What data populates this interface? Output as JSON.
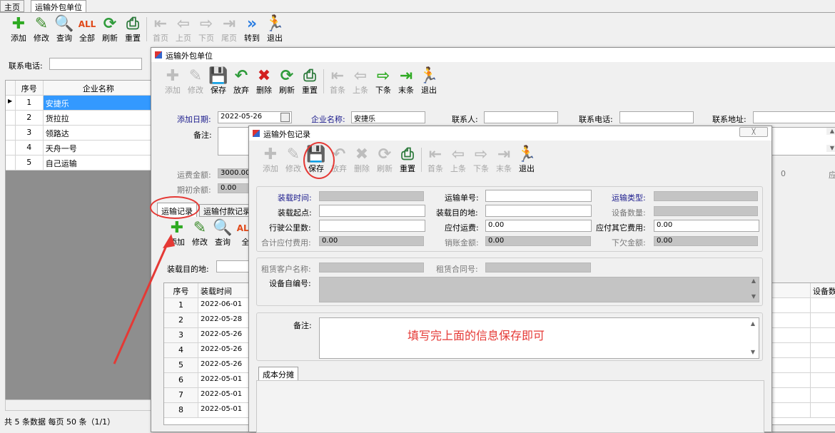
{
  "tabs": [
    "主页",
    "运输外包单位"
  ],
  "main_toolbar": [
    {
      "label": "添加",
      "icon": "add-icon",
      "enabled": true
    },
    {
      "label": "修改",
      "icon": "edit-icon",
      "enabled": true
    },
    {
      "label": "查询",
      "icon": "search-icon",
      "enabled": true
    },
    {
      "label": "全部",
      "icon": "all-icon",
      "enabled": true
    },
    {
      "label": "刷新",
      "icon": "refresh-icon",
      "enabled": true
    },
    {
      "label": "重置",
      "icon": "reset-icon",
      "enabled": true
    },
    {
      "label": "首页",
      "icon": "first-icon",
      "enabled": false
    },
    {
      "label": "上页",
      "icon": "prev-icon",
      "enabled": false
    },
    {
      "label": "下页",
      "icon": "next-icon",
      "enabled": false
    },
    {
      "label": "尾页",
      "icon": "last-icon",
      "enabled": false
    },
    {
      "label": "转到",
      "icon": "goto-icon",
      "enabled": true
    },
    {
      "label": "退出",
      "icon": "exit-icon",
      "enabled": true
    }
  ],
  "filter": {
    "phone_label": "联系电话:"
  },
  "company_grid": {
    "headers": [
      "序号",
      "企业名称"
    ],
    "rows": [
      {
        "no": "1",
        "name": "安捷乐"
      },
      {
        "no": "2",
        "name": "货拉拉"
      },
      {
        "no": "3",
        "name": "领路达"
      },
      {
        "no": "4",
        "name": "天舟一号"
      },
      {
        "no": "5",
        "name": "自己运输"
      }
    ]
  },
  "status": "共 5 条数据  每页 50 条（1/1）",
  "unit_window": {
    "title": "运输外包单位",
    "toolbar": [
      {
        "label": "添加",
        "icon": "add-icon",
        "enabled": false
      },
      {
        "label": "修改",
        "icon": "edit-icon",
        "enabled": false
      },
      {
        "label": "保存",
        "icon": "save-icon",
        "enabled": true
      },
      {
        "label": "放弃",
        "icon": "undo-icon",
        "enabled": true
      },
      {
        "label": "删除",
        "icon": "delete-icon",
        "enabled": true
      },
      {
        "label": "刷新",
        "icon": "refresh-icon",
        "enabled": true
      },
      {
        "label": "重置",
        "icon": "reset-icon",
        "enabled": true
      },
      {
        "label": "首条",
        "icon": "first-icon",
        "enabled": false
      },
      {
        "label": "上条",
        "icon": "prev-icon",
        "enabled": false
      },
      {
        "label": "下条",
        "icon": "next-icon",
        "enabled": true
      },
      {
        "label": "末条",
        "icon": "last-icon",
        "enabled": true
      },
      {
        "label": "退出",
        "icon": "exit-icon",
        "enabled": true
      }
    ],
    "add_date_label": "添加日期:",
    "add_date": "2022-05-26",
    "company_label": "企业名称:",
    "company": "安捷乐",
    "contact_label": "联系人:",
    "phone_label": "联系电话:",
    "address_label": "联系地址:",
    "remark_label": "备注:",
    "freight_label": "运费金额:",
    "freight": "3000.00",
    "opening_label": "期初余额:",
    "opening": "0.00",
    "right_value": "0",
    "right_suffix": "应",
    "subtabs": [
      "运输记录",
      "运输付款记录"
    ],
    "sub_toolbar": [
      {
        "label": "添加",
        "icon": "add-icon"
      },
      {
        "label": "修改",
        "icon": "edit-icon"
      },
      {
        "label": "查询",
        "icon": "search-icon"
      },
      {
        "label": "全",
        "icon": "all-icon"
      }
    ],
    "dest_label": "装载目的地:",
    "record_headers": [
      "序号",
      "装载时间"
    ],
    "right_header": "设备数",
    "records": [
      {
        "no": "1",
        "date": "2022-06-01"
      },
      {
        "no": "2",
        "date": "2022-05-28"
      },
      {
        "no": "3",
        "date": "2022-05-26"
      },
      {
        "no": "4",
        "date": "2022-05-26"
      },
      {
        "no": "5",
        "date": "2022-05-26"
      },
      {
        "no": "6",
        "date": "2022-05-01"
      },
      {
        "no": "7",
        "date": "2022-05-01"
      },
      {
        "no": "8",
        "date": "2022-05-01"
      }
    ]
  },
  "record_window": {
    "title": "运输外包记录",
    "close_label": "╳",
    "toolbar": [
      {
        "label": "添加",
        "icon": "add-icon",
        "enabled": false
      },
      {
        "label": "修改",
        "icon": "edit-icon",
        "enabled": false
      },
      {
        "label": "保存",
        "icon": "save-icon",
        "enabled": true
      },
      {
        "label": "放弃",
        "icon": "undo-icon",
        "enabled": false
      },
      {
        "label": "删除",
        "icon": "delete-icon",
        "enabled": false
      },
      {
        "label": "刷新",
        "icon": "refresh-icon",
        "enabled": false
      },
      {
        "label": "重置",
        "icon": "reset-icon",
        "enabled": true
      },
      {
        "label": "首条",
        "icon": "first-icon",
        "enabled": false
      },
      {
        "label": "上条",
        "icon": "prev-icon",
        "enabled": false
      },
      {
        "label": "下条",
        "icon": "next-icon",
        "enabled": false
      },
      {
        "label": "末条",
        "icon": "last-icon",
        "enabled": false
      },
      {
        "label": "退出",
        "icon": "exit-icon",
        "enabled": true
      }
    ],
    "load_time_label": "装载时间:",
    "waybill_label": "运输单号:",
    "transport_type_label": "运输类型:",
    "load_origin_label": "装载起点:",
    "load_dest_label": "装载目的地:",
    "device_qty_label": "设备数量:",
    "km_label": "行驶公里数:",
    "freight_payable_label": "应付运费:",
    "freight_payable": "0.00",
    "other_payable_label": "应付其它费用:",
    "other_payable": "0.00",
    "total_payable_label": "合计应付费用:",
    "total_payable": "0.00",
    "writeoff_label": "销账金额:",
    "writeoff": "0.00",
    "owed_label": "下欠金额:",
    "owed": "0.00",
    "rent_customer_label": "租赁客户名称:",
    "rent_contract_label": "租赁合同号:",
    "device_code_label": "设备自编号:",
    "remark_label": "备注:",
    "cost_tab": "成本分摊"
  },
  "annotation": {
    "text": "填写完上面的信息保存即可",
    "color": "#e53935"
  }
}
